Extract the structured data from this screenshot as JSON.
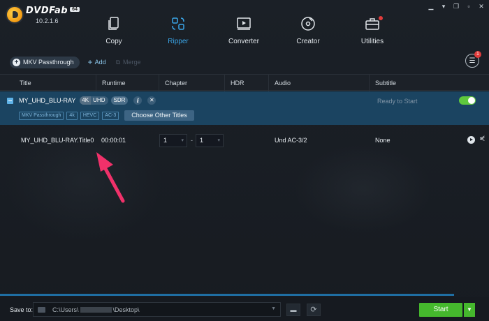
{
  "app": {
    "name": "DVDFab",
    "badge": "64",
    "version": "10.2.1.6"
  },
  "nav": [
    {
      "label": "Copy",
      "icon": "copy-icon"
    },
    {
      "label": "Ripper",
      "icon": "ripper-icon",
      "active": true
    },
    {
      "label": "Converter",
      "icon": "converter-icon"
    },
    {
      "label": "Creator",
      "icon": "creator-icon"
    },
    {
      "label": "Utilities",
      "icon": "utilities-icon",
      "notification": true
    }
  ],
  "toolbar": {
    "profile": "MKV Passthrough",
    "add": "Add",
    "merge": "Merge",
    "menu_badge": "1"
  },
  "columns": [
    "Title",
    "Runtime",
    "Chapter",
    "HDR",
    "Audio",
    "Subtitle"
  ],
  "source": {
    "name": "MY_UHD_BLU-RAY",
    "tag_4k": "4K",
    "tag_uhd": "UHD",
    "tag_sdr": "SDR",
    "status": "Ready to Start",
    "toggle_on": true,
    "chips": [
      "MKV Passthrough",
      "4k",
      "HEVC",
      "AC-3"
    ],
    "choose_button": "Choose Other Titles"
  },
  "title_row": {
    "name": "MY_UHD_BLU-RAY.Title0",
    "runtime": "00:00:01",
    "chapter_start": "1",
    "chapter_sep": "-",
    "chapter_end": "1",
    "audio": "Und AC-3/2",
    "subtitle": "None"
  },
  "bottom": {
    "save_label": "Save to:",
    "path_prefix": "C:\\Users\\",
    "path_suffix": "\\Desktop\\",
    "start": "Start"
  },
  "colors": {
    "accent": "#3aa6e8",
    "selected_row": "#1b4461",
    "start": "#45b82d",
    "annotation_arrow": "#f0316a"
  }
}
